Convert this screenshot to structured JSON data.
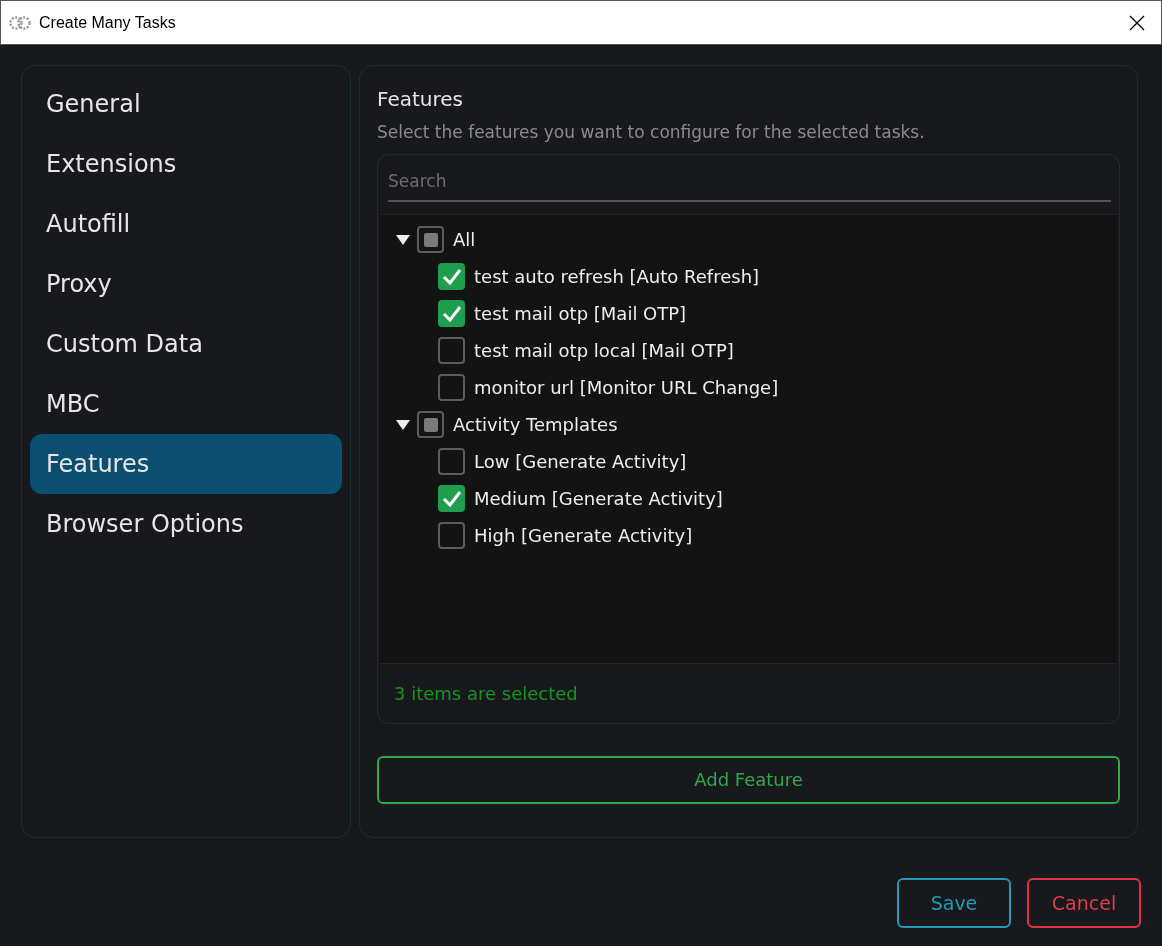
{
  "window": {
    "title": "Create Many Tasks"
  },
  "sidebar": {
    "items": [
      {
        "label": "General",
        "selected": false
      },
      {
        "label": "Extensions",
        "selected": false
      },
      {
        "label": "Autofill",
        "selected": false
      },
      {
        "label": "Proxy",
        "selected": false
      },
      {
        "label": "Custom Data",
        "selected": false
      },
      {
        "label": "MBC",
        "selected": false
      },
      {
        "label": "Features",
        "selected": true
      },
      {
        "label": "Browser Options",
        "selected": false
      }
    ]
  },
  "panel": {
    "title": "Features",
    "subtitle": "Select the features you want to configure for the selected tasks.",
    "search": {
      "placeholder": "Search"
    },
    "tree": [
      {
        "label": "All",
        "expanded": true,
        "checked": false,
        "indeterminate": true,
        "children": [
          {
            "label": "test auto refresh [Auto Refresh]",
            "checked": true
          },
          {
            "label": "test mail otp [Mail OTP]",
            "checked": true
          },
          {
            "label": "test mail otp local [Mail OTP]",
            "checked": false
          },
          {
            "label": "monitor url [Monitor URL Change]",
            "checked": false
          }
        ]
      },
      {
        "label": "Activity Templates",
        "expanded": true,
        "checked": false,
        "indeterminate": true,
        "children": [
          {
            "label": "Low [Generate Activity]",
            "checked": false
          },
          {
            "label": "Medium [Generate Activity]",
            "checked": true
          },
          {
            "label": "High [Generate Activity]",
            "checked": false
          }
        ]
      }
    ],
    "selection_status": "3 items are selected",
    "add_button": "Add Feature"
  },
  "buttons": {
    "save": "Save",
    "cancel": "Cancel"
  }
}
